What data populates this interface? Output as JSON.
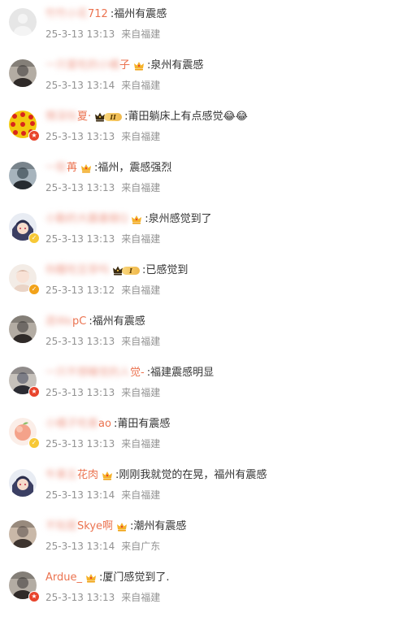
{
  "colors": {
    "username": "#eb7350",
    "comment_text": "#333333",
    "meta_text": "#939393",
    "verify_orange": "#f2a219",
    "verify_yellow": "#f7c836",
    "verify_red": "#e8442c"
  },
  "comments": [
    {
      "user_prefix": "竹竹小花",
      "user_suffix": "712",
      "badge": "none",
      "text": "福州有震感",
      "date": "25-3-13",
      "time": "13:13",
      "source": "来自福建",
      "avatar_icon": "default-avatar-icon",
      "verify": "none"
    },
    {
      "user_prefix": "一只爱吃的小橘",
      "user_suffix": "子",
      "badge": "crown",
      "text": "泉州有震感",
      "date": "25-3-13",
      "time": "13:14",
      "source": "来自福建",
      "avatar_icon": "user-photo-avatar-icon",
      "verify": "none"
    },
    {
      "user_prefix": "情深似",
      "user_suffix": "夏·",
      "badge": "vip",
      "vip_level": "II",
      "text": "莆田躺床上有点感觉😂😂",
      "date": "25-3-13",
      "time": "13:13",
      "source": "来自福建",
      "avatar_icon": "yellow-pattern-avatar-icon",
      "verify": "red"
    },
    {
      "user_prefix": "一软",
      "user_suffix": "苒",
      "badge": "crown",
      "text": "福州，震感强烈",
      "date": "25-3-13",
      "time": "13:13",
      "source": "来自福建",
      "avatar_icon": "user-photo-avatar-icon",
      "verify": "none"
    },
    {
      "user_prefix": "小動的大圖書館Q",
      "user_suffix": "",
      "badge": "crown",
      "text": "泉州感觉到了",
      "date": "25-3-13",
      "time": "13:13",
      "source": "来自福建",
      "avatar_icon": "anime-avatar-icon",
      "verify": "yellow"
    },
    {
      "user_prefix": "你醒吃豆芽吗",
      "user_suffix": "",
      "badge": "vip",
      "vip_level": "I",
      "text": "已感觉到",
      "date": "25-3-13",
      "time": "13:12",
      "source": "来自福建",
      "avatar_icon": "light-avatar-icon",
      "verify": "orange"
    },
    {
      "user_prefix": "连Wa",
      "user_suffix": "pC",
      "badge": "none",
      "text": "福州有震感",
      "date": "25-3-13",
      "time": "13:13",
      "source": "来自福建",
      "avatar_icon": "user-photo-avatar-icon",
      "verify": "none"
    },
    {
      "user_prefix": "一只不想睡觉的人",
      "user_suffix": "觉-",
      "badge": "none",
      "text": "福建震感明显",
      "date": "25-3-13",
      "time": "13:13",
      "source": "来自福建",
      "avatar_icon": "user-photo-avatar-icon",
      "verify": "red"
    },
    {
      "user_prefix": "小橘子吃香",
      "user_suffix": "ao",
      "badge": "none",
      "text": "莆田有震感",
      "date": "25-3-13",
      "time": "13:13",
      "source": "来自福建",
      "avatar_icon": "peach-avatar-icon",
      "verify": "yellow"
    },
    {
      "user_prefix": "牛果五",
      "user_suffix": "花肉",
      "badge": "crown",
      "text": "刚刚我就觉的在晃，福州有震感",
      "date": "25-3-13",
      "time": "13:14",
      "source": "来自福建",
      "avatar_icon": "anime-avatar-icon",
      "verify": "none"
    },
    {
      "user_prefix": "不知是",
      "user_suffix": "Skye啊",
      "badge": "crown",
      "text": "潮州有震感",
      "date": "25-3-13",
      "time": "13:14",
      "source": "来自广东",
      "avatar_icon": "user-photo-avatar-icon",
      "verify": "none"
    },
    {
      "user_prefix": "",
      "user_suffix": "Ardue_",
      "badge": "crown",
      "text": "厦门感觉到了.",
      "date": "25-3-13",
      "time": "13:13",
      "source": "来自福建",
      "avatar_icon": "user-photo-avatar-icon",
      "verify": "red"
    }
  ]
}
